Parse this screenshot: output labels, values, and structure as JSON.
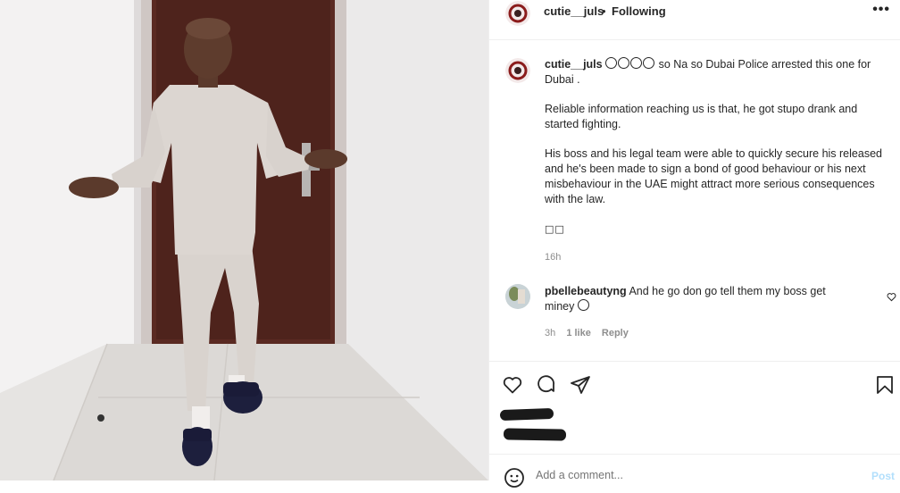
{
  "post": {
    "username": "cutie__juls",
    "separator": "•",
    "follow_status": "Following",
    "more_icon": "•••"
  },
  "caption": {
    "username": "cutie__juls",
    "line1": " so Na so Dubai Police arrested this one for Dubai .",
    "para2": "Reliable information reaching us is that, he got stupo drank and started fighting.",
    "para3": "His boss and his legal team were able to quickly secure his released and he's been made to sign a bond of good behaviour or his next misbehaviour in the UAE might attract more serious consequences with the law.",
    "emoji_boxes": "□□",
    "time": "16h"
  },
  "comment": {
    "username": "pbellebeautyng",
    "text": " And he go don go tell them my boss get miney ",
    "time": "3h",
    "likes": "1 like",
    "reply": "Reply"
  },
  "add_comment": {
    "placeholder": "Add a comment...",
    "post_label": "Post"
  },
  "icons": [
    "heart-icon",
    "comment-icon",
    "share-icon",
    "bookmark-icon",
    "smiley-icon",
    "more-icon"
  ],
  "colors": {
    "text": "#262626",
    "secondary": "#8e8e8e",
    "post_disabled": "#b2dffc",
    "border": "#efefef"
  }
}
